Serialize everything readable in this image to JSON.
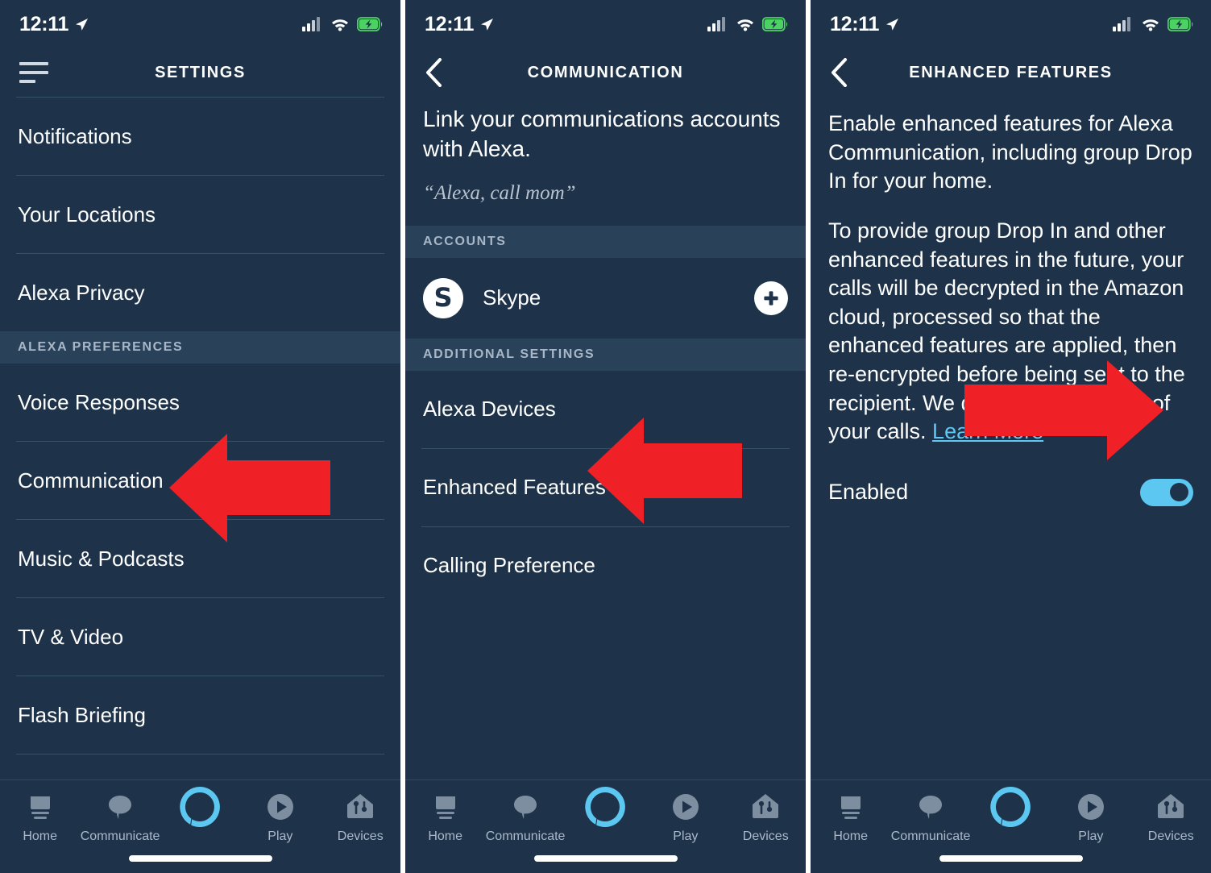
{
  "colors": {
    "background": "#1e3349",
    "section_header_bg": "#2a4259",
    "divider": "#37506a",
    "accent_blue": "#5cc8f2",
    "link_blue": "#5fc8f5",
    "arrow_red": "#ef2026",
    "muted_text": "#a8b7c7",
    "battery_green": "#4cd263"
  },
  "status_bar": {
    "time": "12:11",
    "location_icon": "location-arrow-icon",
    "signal_icon": "cellular-signal-icon",
    "wifi_icon": "wifi-icon",
    "battery_icon": "battery-charging-icon"
  },
  "screen1": {
    "menu_icon": "hamburger-menu-icon",
    "title": "SETTINGS",
    "items": [
      {
        "label": "Notifications",
        "type": "row"
      },
      {
        "label": "Your Locations",
        "type": "row"
      },
      {
        "label": "Alexa Privacy",
        "type": "row"
      },
      {
        "label": "ALEXA PREFERENCES",
        "type": "section"
      },
      {
        "label": "Voice Responses",
        "type": "row"
      },
      {
        "label": "Communication",
        "type": "row"
      },
      {
        "label": "Music & Podcasts",
        "type": "row"
      },
      {
        "label": "TV & Video",
        "type": "row"
      },
      {
        "label": "Flash Briefing",
        "type": "row"
      }
    ],
    "annotation_arrow": "left-arrow-pointing-to-communication"
  },
  "screen2": {
    "back_icon": "back-chevron-icon",
    "title": "COMMUNICATION",
    "intro": "Link your communications accounts with Alexa.",
    "quote": "“Alexa, call mom”",
    "accounts_header": "ACCOUNTS",
    "account": {
      "icon": "skype-icon",
      "icon_glyph": "S",
      "name": "Skype",
      "add_icon": "plus-circle-icon"
    },
    "additional_header": "ADDITIONAL SETTINGS",
    "items": [
      {
        "label": "Alexa Devices"
      },
      {
        "label": "Enhanced Features"
      },
      {
        "label": "Calling Preference"
      }
    ],
    "annotation_arrow": "left-arrow-pointing-to-enhanced-features"
  },
  "screen3": {
    "back_icon": "back-chevron-icon",
    "title": "ENHANCED FEATURES",
    "paragraph1": "Enable enhanced features for Alexa Communication, including group Drop In for your home.",
    "paragraph2": "To provide group Drop In and other enhanced features in the future, your calls will be decrypted in the Amazon cloud, processed so that the enhanced features are applied, then re-encrypted before being sent to the recipient. We do not store a copy of your calls. ",
    "learn_more": "Learn More",
    "toggle_label": "Enabled",
    "toggle_state": "on",
    "annotation_arrow": "right-arrow-pointing-to-enabled-toggle"
  },
  "bottom_nav": {
    "items": [
      {
        "label": "Home",
        "icon": "echo-device-icon",
        "active": false
      },
      {
        "label": "Communicate",
        "icon": "speech-bubble-icon",
        "active": false
      },
      {
        "label": "",
        "icon": "alexa-orb-icon",
        "active": true
      },
      {
        "label": "Play",
        "icon": "play-circle-icon",
        "active": false
      },
      {
        "label": "Devices",
        "icon": "home-devices-icon",
        "active": false
      }
    ]
  }
}
